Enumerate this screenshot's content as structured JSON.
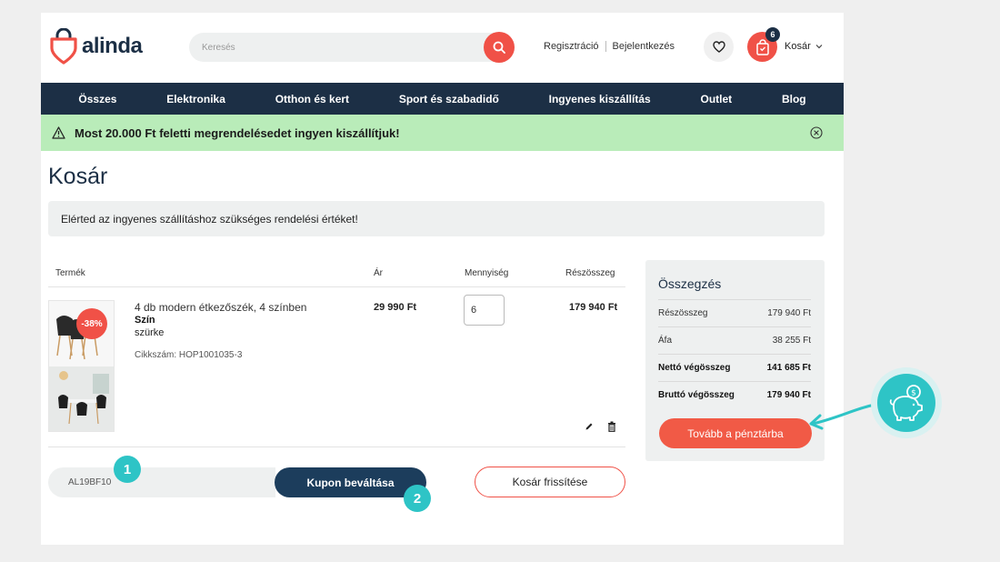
{
  "brand": {
    "name": "alinda",
    "accent": "#f05147",
    "navy": "#1c2f45",
    "teal": "#2ec4c6"
  },
  "search": {
    "placeholder": "Keresés"
  },
  "auth": {
    "register": "Regisztráció",
    "login": "Bejelentkezés"
  },
  "cart": {
    "count": "6",
    "label": "Kosár"
  },
  "nav": [
    "Összes",
    "Elektronika",
    "Otthon és kert",
    "Sport és szabadidő",
    "Ingyenes kiszállítás",
    "Outlet",
    "Blog"
  ],
  "notice": {
    "text": "Most 20.000 Ft feletti megrendelésedet ingyen kiszállítjuk!"
  },
  "page_title": "Kosár",
  "info_message": "Elérted az ingyenes szállításhoz szükséges rendelési értéket!",
  "table": {
    "headers": {
      "products": "Termék",
      "price": "Ár",
      "quantity": "Mennyiség",
      "subtotal": "Részösszeg"
    }
  },
  "product": {
    "discount": "-38%",
    "name": "4 db modern étkezőszék, 4 színben",
    "attr_label": "Szín",
    "attr_value": "szürke",
    "sku": "Cikkszám: HOP1001035-3",
    "price": "29 990 Ft",
    "quantity": "6",
    "subtotal": "179 940 Ft"
  },
  "coupon": {
    "value": "AL19BF10",
    "apply_label": "Kupon beváltása"
  },
  "refresh_label": "Kosár frissítése",
  "steps": {
    "one": "1",
    "two": "2"
  },
  "summary": {
    "title": "Összegzés",
    "rows": [
      {
        "label": "Részösszeg",
        "value": "179 940 Ft"
      },
      {
        "label": "Áfa",
        "value": "38 255 Ft"
      },
      {
        "label": "Nettó végösszeg",
        "value": "141 685 Ft"
      },
      {
        "label": "Bruttó végösszeg",
        "value": "179 940 Ft"
      }
    ],
    "checkout_label": "Tovább a pénztárba"
  }
}
